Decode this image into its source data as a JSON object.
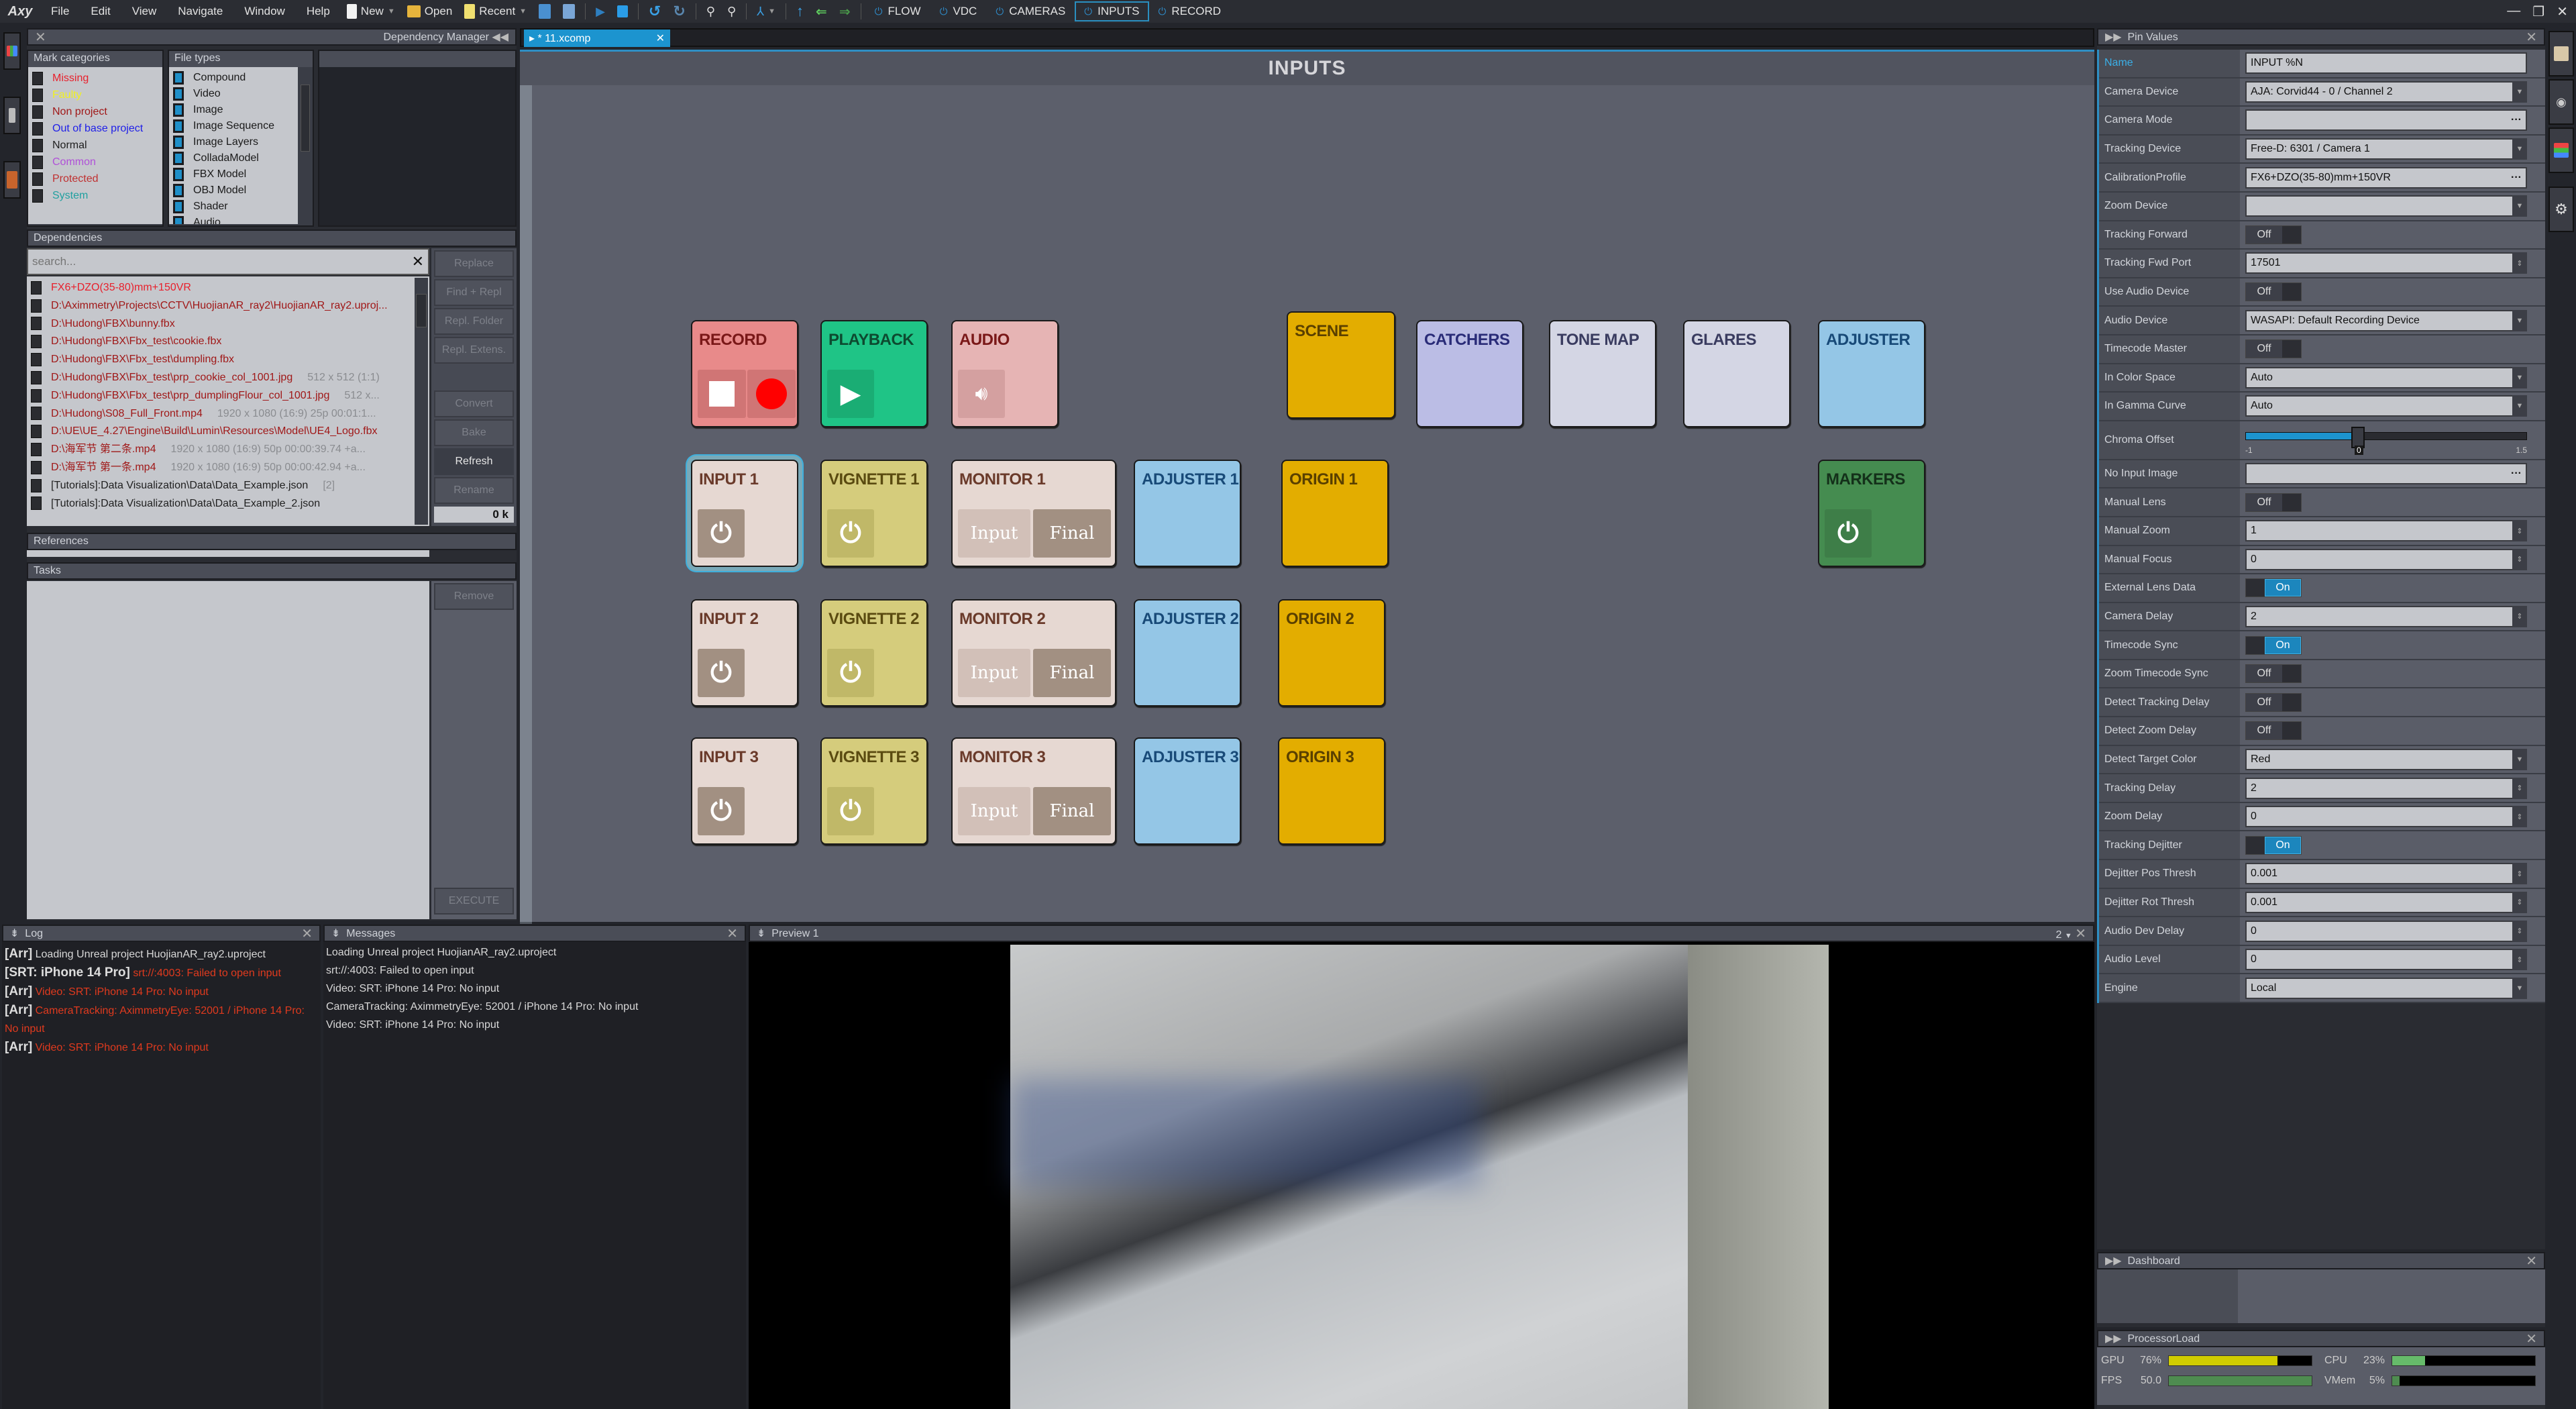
{
  "app": {
    "logo": "Axy",
    "menu": [
      "File",
      "Edit",
      "View",
      "Navigate",
      "Window",
      "Help"
    ],
    "toolbar": {
      "new_label": "New",
      "open_label": "Open",
      "recent_label": "Recent"
    },
    "modes": [
      {
        "label": "FLOW",
        "active": false
      },
      {
        "label": "VDC",
        "active": false
      },
      {
        "label": "CAMERAS",
        "active": false
      },
      {
        "label": "INPUTS",
        "active": true
      },
      {
        "label": "RECORD",
        "active": false
      }
    ]
  },
  "dependency_manager": {
    "title": "Dependency Manager",
    "mark_categories": {
      "header": "Mark categories",
      "items": [
        {
          "label": "Missing",
          "color": "#e8202c"
        },
        {
          "label": "Faulty",
          "color": "#f0f020"
        },
        {
          "label": "Non project",
          "color": "#a01818"
        },
        {
          "label": "Out of base project",
          "color": "#2020e8"
        },
        {
          "label": "Normal",
          "color": "#202020"
        },
        {
          "label": "Common",
          "color": "#b050d8"
        },
        {
          "label": "Protected",
          "color": "#c03030"
        },
        {
          "label": "System",
          "color": "#20a0a0"
        }
      ]
    },
    "file_types": {
      "header": "File types",
      "items": [
        "Compound",
        "Video",
        "Image",
        "Image Sequence",
        "Image Layers",
        "ColladaModel",
        "FBX Model",
        "OBJ Model",
        "Shader",
        "Audio"
      ]
    },
    "dependencies": {
      "header": "Dependencies",
      "search_placeholder": "search...",
      "items": [
        {
          "path": "FX6+DZO(35-80)mm+150VR",
          "info": "",
          "color": "#e8202c"
        },
        {
          "path": "D:\\Aximmetry\\Projects\\CCTV\\HuojianAR_ray2\\HuojianAR_ray2.uproj...",
          "info": "",
          "color": "#a01818"
        },
        {
          "path": "D:\\Hudong\\FBX\\bunny.fbx",
          "info": "",
          "color": "#a01818"
        },
        {
          "path": "D:\\Hudong\\FBX\\Fbx_test\\cookie.fbx",
          "info": "",
          "color": "#a01818"
        },
        {
          "path": "D:\\Hudong\\FBX\\Fbx_test\\dumpling.fbx",
          "info": "",
          "color": "#a01818"
        },
        {
          "path": "D:\\Hudong\\FBX\\Fbx_test\\prp_cookie_col_1001.jpg",
          "info": "512 x 512 (1:1)",
          "color": "#a01818"
        },
        {
          "path": "D:\\Hudong\\FBX\\Fbx_test\\prp_dumplingFlour_col_1001.jpg",
          "info": "512 x...",
          "color": "#a01818"
        },
        {
          "path": "D:\\Hudong\\S08_Full_Front.mp4",
          "info": "1920 x 1080 (16:9) 25p  00:01:1...",
          "color": "#a01818"
        },
        {
          "path": "D:\\UE\\UE_4.27\\Engine\\Build\\Lumin\\Resources\\Model\\UE4_Logo.fbx",
          "info": "",
          "color": "#a01818"
        },
        {
          "path": "D:\\海军节 第二条.mp4",
          "info": "1920 x 1080 (16:9) 50p  00:00:39.74  +a...",
          "color": "#a01818"
        },
        {
          "path": "D:\\海军节 第一条.mp4",
          "info": "1920 x 1080 (16:9) 50p  00:00:42.94  +a...",
          "color": "#a01818"
        },
        {
          "path": "[Tutorials]:Data Visualization\\Data\\Data_Example.json",
          "info": "[2]",
          "color": "#202020"
        },
        {
          "path": "[Tutorials]:Data Visualization\\Data\\Data_Example_2.json",
          "info": "",
          "color": "#202020"
        }
      ],
      "buttons": [
        "Replace",
        "Find + Repl",
        "Repl. Folder",
        "Repl. Extens.",
        "Convert",
        "Bake",
        "Refresh",
        "Rename"
      ],
      "size_readout": "0 k"
    },
    "references": {
      "header": "References"
    },
    "tasks": {
      "header": "Tasks",
      "remove_label": "Remove",
      "execute_label": "EXECUTE"
    }
  },
  "composition": {
    "tab_label": "* 11.xcomp",
    "title": "INPUTS",
    "tiles": [
      {
        "label": "RECORD",
        "bg": "#e88a8a",
        "fg": "#7a1818",
        "kind": "record"
      },
      {
        "label": "PLAYBACK",
        "bg": "#1fc486",
        "fg": "#0d4a30",
        "kind": "play"
      },
      {
        "label": "AUDIO",
        "bg": "#e6b4b4",
        "fg": "#7a1818",
        "kind": "audio"
      },
      {
        "label": "SCENE",
        "bg": "#e3ad00",
        "fg": "#5a4000",
        "kind": "none"
      },
      {
        "label": "CATCHERS",
        "bg": "#bbbde5",
        "fg": "#2a2c78",
        "kind": "none"
      },
      {
        "label": "TONE MAP",
        "bg": "#d4d6e4",
        "fg": "#3a3c60",
        "kind": "none"
      },
      {
        "label": "GLARES",
        "bg": "#d4d6e4",
        "fg": "#3a3c60",
        "kind": "none"
      },
      {
        "label": "ADJUSTER",
        "bg": "#94c6e6",
        "fg": "#184a78",
        "kind": "none"
      },
      {
        "label": "INPUT 1",
        "bg": "#e6d8d2",
        "fg": "#6a3a2a",
        "kind": "power",
        "selected": true
      },
      {
        "label": "VIGNETTE 1",
        "bg": "#d5cc7c",
        "fg": "#5a4a10",
        "kind": "power"
      },
      {
        "label": "MONITOR 1",
        "bg": "#e6d8d2",
        "fg": "#6a3a2a",
        "kind": "monitor"
      },
      {
        "label": "ADJUSTER 1",
        "bg": "#94c6e6",
        "fg": "#184a78",
        "kind": "none"
      },
      {
        "label": "ORIGIN 1",
        "bg": "#e3ad00",
        "fg": "#5a4000",
        "kind": "none"
      },
      {
        "label": "MARKERS",
        "bg": "#458c50",
        "fg": "#14301a",
        "kind": "power"
      },
      {
        "label": "INPUT 2",
        "bg": "#e6d8d2",
        "fg": "#6a3a2a",
        "kind": "power"
      },
      {
        "label": "VIGNETTE 2",
        "bg": "#d5cc7c",
        "fg": "#5a4a10",
        "kind": "power"
      },
      {
        "label": "MONITOR 2",
        "bg": "#e6d8d2",
        "fg": "#6a3a2a",
        "kind": "monitor"
      },
      {
        "label": "ADJUSTER 2",
        "bg": "#94c6e6",
        "fg": "#184a78",
        "kind": "none"
      },
      {
        "label": "ORIGIN 2",
        "bg": "#e3ad00",
        "fg": "#5a4000",
        "kind": "none"
      },
      {
        "label": "INPUT 3",
        "bg": "#e6d8d2",
        "fg": "#6a3a2a",
        "kind": "power"
      },
      {
        "label": "VIGNETTE 3",
        "bg": "#d5cc7c",
        "fg": "#5a4a10",
        "kind": "power"
      },
      {
        "label": "MONITOR 3",
        "bg": "#e6d8d2",
        "fg": "#6a3a2a",
        "kind": "monitor"
      },
      {
        "label": "ADJUSTER 3",
        "bg": "#94c6e6",
        "fg": "#184a78",
        "kind": "none"
      },
      {
        "label": "ORIGIN 3",
        "bg": "#e3ad00",
        "fg": "#5a4000",
        "kind": "none"
      }
    ],
    "monitor_buttons": {
      "input": "Input",
      "final": "Final"
    }
  },
  "log": {
    "title": "Log",
    "lines": [
      {
        "tag": "[Arr]",
        "text": "Loading Unreal project HuojianAR_ray2.uproject",
        "error": false
      },
      {
        "tag": "[SRT: iPhone 14 Pro]",
        "text": "srt://:4003: Failed to open input",
        "error": true
      },
      {
        "tag": "[Arr]",
        "text": "Video: SRT: iPhone 14 Pro: No input",
        "error": true
      },
      {
        "tag": "[Arr]",
        "text": "CameraTracking: AximmetryEye: 52001 / iPhone 14 Pro: No input",
        "error": true
      },
      {
        "tag": "[Arr]",
        "text": "Video: SRT: iPhone 14 Pro: No input",
        "error": true
      }
    ]
  },
  "messages": {
    "title": "Messages",
    "lines": [
      {
        "text": "Loading Unreal project HuojianAR_ray2.uproject",
        "error": false
      },
      {
        "text": "srt://:4003: Failed to open input",
        "error": true
      },
      {
        "text": "Video: SRT: iPhone 14 Pro: No input",
        "error": true
      },
      {
        "text": "CameraTracking: AximmetryEye: 52001 / iPhone 14 Pro: No input",
        "error": true
      },
      {
        "text": "Video: SRT: iPhone 14 Pro: No input",
        "error": true
      }
    ]
  },
  "preview": {
    "title": "Preview 1",
    "channel": "2"
  },
  "pin_values": {
    "title": "Pin Values",
    "rows": [
      {
        "label": "Name",
        "type": "text",
        "value": "INPUT %N",
        "highlight": true
      },
      {
        "label": "Camera Device",
        "type": "select",
        "value": "AJA: Corvid44 - 0 / Channel 2"
      },
      {
        "label": "Camera Mode",
        "type": "browse",
        "value": ""
      },
      {
        "label": "Tracking Device",
        "type": "select",
        "value": "Free-D: 6301 / Camera 1"
      },
      {
        "label": "CalibrationProfile",
        "type": "browse",
        "value": "FX6+DZO(35-80)mm+150VR"
      },
      {
        "label": "Zoom Device",
        "type": "select",
        "value": ""
      },
      {
        "label": "Tracking Forward",
        "type": "toggle",
        "value": "Off"
      },
      {
        "label": "Tracking Fwd Port",
        "type": "number",
        "value": "17501"
      },
      {
        "label": "Use Audio Device",
        "type": "toggle",
        "value": "Off"
      },
      {
        "label": "Audio Device",
        "type": "select",
        "value": "WASAPI: Default Recording Device"
      },
      {
        "label": "Timecode Master",
        "type": "toggle",
        "value": "Off"
      },
      {
        "label": "In Color Space",
        "type": "select",
        "value": "Auto"
      },
      {
        "label": "In Gamma Curve",
        "type": "select",
        "value": "Auto"
      },
      {
        "label": "Chroma Offset",
        "type": "slider",
        "value": "0",
        "min": "-1",
        "max": "1.5",
        "fraction": 0.4
      },
      {
        "label": "No Input Image",
        "type": "browse",
        "value": ""
      },
      {
        "label": "Manual Lens",
        "type": "toggle",
        "value": "Off"
      },
      {
        "label": "Manual Zoom",
        "type": "number",
        "value": "1"
      },
      {
        "label": "Manual Focus",
        "type": "number",
        "value": "0"
      },
      {
        "label": "External Lens Data",
        "type": "toggle",
        "value": "On"
      },
      {
        "label": "Camera Delay",
        "type": "number",
        "value": "2"
      },
      {
        "label": "Timecode Sync",
        "type": "toggle",
        "value": "On"
      },
      {
        "label": "Zoom Timecode Sync",
        "type": "toggle",
        "value": "Off"
      },
      {
        "label": "Detect Tracking Delay",
        "type": "toggle",
        "value": "Off"
      },
      {
        "label": "Detect Zoom Delay",
        "type": "toggle",
        "value": "Off"
      },
      {
        "label": "Detect Target Color",
        "type": "select",
        "value": "Red"
      },
      {
        "label": "Tracking Delay",
        "type": "number",
        "value": "2"
      },
      {
        "label": "Zoom Delay",
        "type": "number",
        "value": "0"
      },
      {
        "label": "Tracking Dejitter",
        "type": "toggle",
        "value": "On"
      },
      {
        "label": "Dejitter Pos Thresh",
        "type": "number",
        "value": "0.001"
      },
      {
        "label": "Dejitter Rot Thresh",
        "type": "number",
        "value": "0.001"
      },
      {
        "label": "Audio Dev Delay",
        "type": "number",
        "value": "0"
      },
      {
        "label": "Audio Level",
        "type": "number",
        "value": "0"
      },
      {
        "label": "Engine",
        "type": "select",
        "value": "Local"
      }
    ]
  },
  "dashboard": {
    "title": "Dashboard"
  },
  "processor_load": {
    "title": "ProcessorLoad",
    "gpu": {
      "label": "GPU",
      "value": "76%",
      "fraction": 0.76,
      "color": "#d0cc00"
    },
    "cpu": {
      "label": "CPU",
      "value": "23%",
      "fraction": 0.23,
      "color": "#66bb6a"
    },
    "fps": {
      "label": "FPS",
      "value": "50.0",
      "fraction": 1.0,
      "color": "#4e8c50"
    },
    "vmem": {
      "label": "VMem",
      "value": "5%",
      "fraction": 0.05,
      "color": "#4e8c50"
    }
  }
}
